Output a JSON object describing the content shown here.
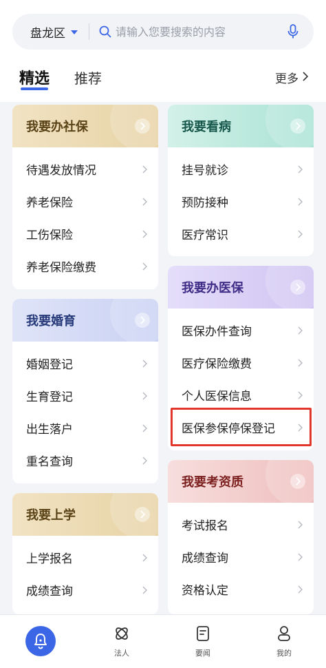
{
  "header": {
    "district": "盘龙区",
    "search_placeholder": "请输入您要搜索的内容"
  },
  "tabs": {
    "active": "精选",
    "other": "推荐",
    "more": "更多"
  },
  "cards": {
    "social": {
      "title": "我要办社保",
      "items": [
        "待遇发放情况",
        "养老保险",
        "工伤保险",
        "养老保险缴费"
      ]
    },
    "marriage": {
      "title": "我要婚育",
      "items": [
        "婚姻登记",
        "生育登记",
        "出生落户",
        "重名查询"
      ]
    },
    "school": {
      "title": "我要上学",
      "items": [
        "上学报名",
        "成绩查询"
      ]
    },
    "doctor": {
      "title": "我要看病",
      "items": [
        "挂号就诊",
        "预防接种",
        "医疗常识"
      ]
    },
    "medins": {
      "title": "我要办医保",
      "items": [
        "医保办件查询",
        "医疗保险缴费",
        "个人医保信息",
        "医保参保停保登记"
      ]
    },
    "exam": {
      "title": "我要考资质",
      "items": [
        "考试报名",
        "成绩查询",
        "资格认定"
      ]
    }
  },
  "bottom_nav": {
    "items": [
      "法人",
      "要闻",
      "我的"
    ]
  },
  "colors": {
    "accent": "#3b66e6",
    "highlight": "#e2352b"
  }
}
